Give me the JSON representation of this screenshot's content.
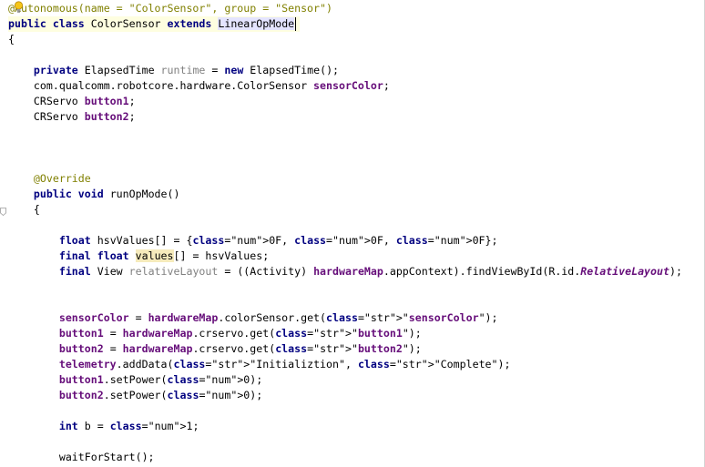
{
  "editor": {
    "lines": [
      "@Autonomous(name = \"ColorSensor\", group = \"Sensor\")",
      "public class ColorSensor extends LinearOpMode",
      "{",
      "",
      "    private ElapsedTime runtime = new ElapsedTime();",
      "    com.qualcomm.robotcore.hardware.ColorSensor sensorColor;",
      "    CRServo button1;",
      "    CRServo button2;",
      "",
      "",
      "",
      "    @Override",
      "    public void runOpMode()",
      "    {",
      "",
      "        float hsvValues[] = {0F, 0F, 0F};",
      "        final float values[] = hsvValues;",
      "        final View relativeLayout = ((Activity) hardwareMap.appContext).findViewById(R.id.RelativeLayout);",
      "",
      "",
      "        sensorColor = hardwareMap.colorSensor.get(\"sensorColor\");",
      "        button1 = hardwareMap.crservo.get(\"button1\");",
      "        button2 = hardwareMap.crservo.get(\"button2\");",
      "        telemetry.addData(\"Initializtion\", \"Complete\");",
      "        button1.setPower(0);",
      "        button2.setPower(0);",
      "",
      "        int b = 1;",
      "",
      "        waitForStart();"
    ],
    "gutter_icons": [
      "lightbulb-icon",
      "fold-marker-icon"
    ],
    "colors": {
      "keyword": "#000080",
      "string": "#008000",
      "number": "#0000ff",
      "field": "#660e7a",
      "unused": "#808080",
      "annotation": "#808000",
      "current_line": "#fefee0",
      "reference_highlight": "#f6ebbc",
      "class_highlight": "#e4e4ff"
    }
  }
}
